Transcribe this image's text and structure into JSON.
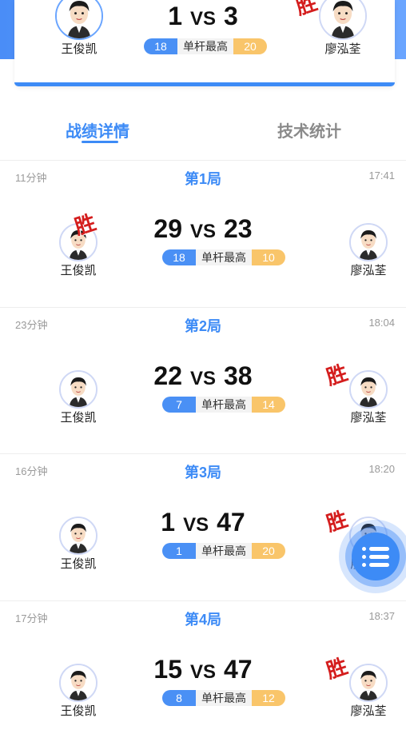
{
  "summary": {
    "left_player": "王俊凯",
    "right_player": "廖泓荃",
    "left_score": "1",
    "vs": "VS",
    "right_score": "3",
    "high_break_label": "单杆最高",
    "left_high_break": "18",
    "right_high_break": "20",
    "winner_mark": "胜"
  },
  "tabs": [
    {
      "label": "战绩详情",
      "active": true
    },
    {
      "label": "技术统计",
      "active": false
    }
  ],
  "games": [
    {
      "duration": "11分钟",
      "title": "第1局",
      "time": "17:41",
      "left_score": "29",
      "right_score": "23",
      "left_break": "18",
      "right_break": "10",
      "winner": "left"
    },
    {
      "duration": "23分钟",
      "title": "第2局",
      "time": "18:04",
      "left_score": "22",
      "right_score": "38",
      "left_break": "7",
      "right_break": "14",
      "winner": "right"
    },
    {
      "duration": "16分钟",
      "title": "第3局",
      "time": "18:20",
      "left_score": "1",
      "right_score": "47",
      "left_break": "1",
      "right_break": "20",
      "winner": "right"
    },
    {
      "duration": "17分钟",
      "title": "第4局",
      "time": "18:37",
      "left_score": "15",
      "right_score": "47",
      "left_break": "8",
      "right_break": "12",
      "winner": "right"
    }
  ],
  "common": {
    "vs": "VS",
    "high_break_label": "单杆最高",
    "winner_mark": "胜",
    "left_player": "王俊凯",
    "right_player": "廖泓荃"
  },
  "fab": {
    "icon": "list-icon"
  },
  "colors": {
    "accent": "#3d8bf6",
    "left_bar": "#4a90f5",
    "right_bar": "#f9c56a",
    "winner": "#d41d1d"
  }
}
